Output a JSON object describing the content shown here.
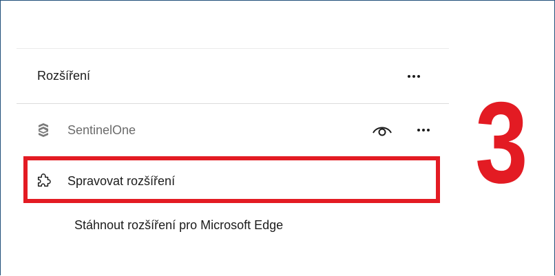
{
  "menu": {
    "title": "Rozšíření",
    "more_label": "···",
    "extensions": [
      {
        "name": "SentinelOne",
        "icon": "sentinelone-icon"
      }
    ],
    "manage_label": "Spravovat rozšíření",
    "get_extensions_label": "Stáhnout rozšíření pro Microsoft Edge"
  },
  "annotation": {
    "step_number": "3",
    "color": "#e31b23"
  }
}
